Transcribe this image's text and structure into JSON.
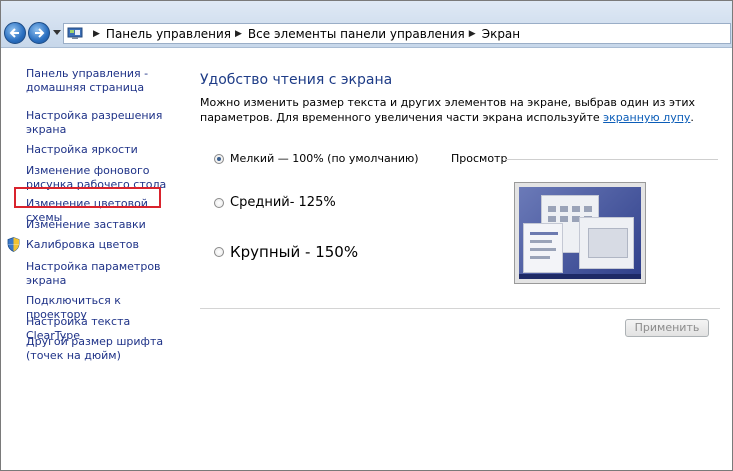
{
  "breadcrumb": {
    "items": [
      "Панель управления",
      "Все элементы панели управления",
      "Экран"
    ]
  },
  "sidebar": {
    "items": [
      {
        "label": "Панель управления - домашняя страница"
      },
      {
        "label": "Настройка разрешения экрана"
      },
      {
        "label": "Настройка яркости"
      },
      {
        "label": "Изменение фонового рисунка рабочего стола"
      },
      {
        "label": "Изменение цветовой схемы"
      },
      {
        "label": "Изменение заставки"
      },
      {
        "label": "Калибровка цветов"
      },
      {
        "label": "Настройка параметров экрана"
      },
      {
        "label": "Подключиться к проектору"
      },
      {
        "label": "Настройка текста ClearType"
      },
      {
        "label": "Другой размер шрифта (точек на дюйм)"
      }
    ],
    "highlighted_item": "Настройка яркости"
  },
  "main": {
    "heading": "Удобство чтения с экрана",
    "description_part1": "Можно изменить размер текста и других элементов на экране, выбрав один из этих параметров. Для временного увеличения части экрана используйте ",
    "description_link": "экранную лупу",
    "description_part2": ".",
    "options": [
      {
        "label": "Мелкий — 100% (по умолчанию)",
        "selected": true
      },
      {
        "label": "Средний- 125%",
        "selected": false
      },
      {
        "label": "Крупный - 150%",
        "selected": false
      }
    ],
    "preview_label": "Просмотр",
    "apply_button": "Применить"
  },
  "colors": {
    "link": "#1e3287",
    "heading": "#1e3c87",
    "highlight_border": "#d9232d"
  }
}
